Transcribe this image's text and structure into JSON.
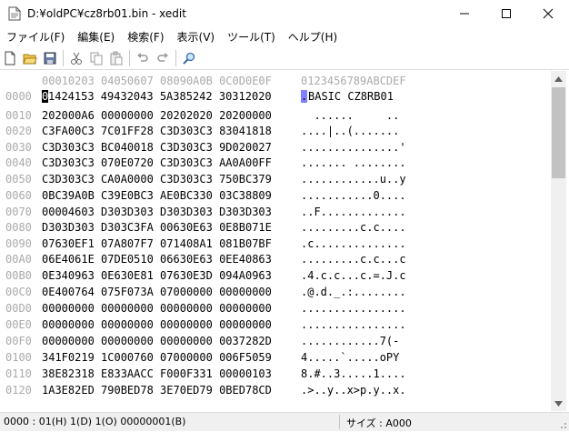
{
  "window": {
    "title": "D:¥oldPC¥cz8rb01.bin - xedit",
    "minimize_icon": "minimize-icon",
    "maximize_icon": "maximize-icon",
    "close_icon": "close-icon"
  },
  "menu": [
    {
      "label": "ファイル(F)"
    },
    {
      "label": "編集(E)"
    },
    {
      "label": "検索(F)"
    },
    {
      "label": "表示(V)"
    },
    {
      "label": "ツール(T)"
    },
    {
      "label": "ヘルプ(H)"
    }
  ],
  "toolbar": [
    "new-file-icon",
    "open-folder-icon",
    "save-icon",
    "cut-icon",
    "copy-icon",
    "paste-icon",
    "undo-icon",
    "redo-icon",
    "search-icon"
  ],
  "editor": {
    "header_hex": "00010203 04050607 08090A0B 0C0D0E0F",
    "header_ascii": "0123456789ABCDEF",
    "first_row": {
      "addr": "0000",
      "caret_hex": "0",
      "hex_rest": "1424153 49432043 5A385242 30312020",
      "caret_ascii": ".",
      "ascii_rest": "BASIC CZ8RB01"
    },
    "rows": [
      {
        "addr": "0010",
        "hex": "202000A6 00000000 20202020 20200000",
        "ascii": "  ......     .."
      },
      {
        "addr": "0020",
        "hex": "C3FA00C3 7C01FF28 C3D303C3 83041818",
        "ascii": "....|..(......."
      },
      {
        "addr": "0030",
        "hex": "C3D303C3 BC040018 C3D303C3 9D020027",
        "ascii": "...............'"
      },
      {
        "addr": "0040",
        "hex": "C3D303C3 070E0720 C3D303C3 AA0A00FF",
        "ascii": "....... ........"
      },
      {
        "addr": "0050",
        "hex": "C3D303C3 CA0A0000 C3D303C3 750BC379",
        "ascii": "............u..y"
      },
      {
        "addr": "0060",
        "hex": "0BC39A0B C39E0BC3 AE0BC330 03C38809",
        "ascii": "...........0...."
      },
      {
        "addr": "0070",
        "hex": "00004603 D303D303 D303D303 D303D303",
        "ascii": "..F............."
      },
      {
        "addr": "0080",
        "hex": "D303D303 D303C3FA 00630E63 0E8B071E",
        "ascii": ".........c.c...."
      },
      {
        "addr": "0090",
        "hex": "07630EF1 07A807F7 071408A1 081B07BF",
        "ascii": ".c.............."
      },
      {
        "addr": "00A0",
        "hex": "06E4061E 07DE0510 06630E63 0EE40863",
        "ascii": ".........c.c...c"
      },
      {
        "addr": "00B0",
        "hex": "0E340963 0E630E81 07630E3D 094A0963",
        "ascii": ".4.c.c...c.=.J.c"
      },
      {
        "addr": "00C0",
        "hex": "0E400764 075F073A 07000000 00000000",
        "ascii": ".@.d._.:........"
      },
      {
        "addr": "00D0",
        "hex": "00000000 00000000 00000000 00000000",
        "ascii": "................"
      },
      {
        "addr": "00E0",
        "hex": "00000000 00000000 00000000 00000000",
        "ascii": "................"
      },
      {
        "addr": "00F0",
        "hex": "00000000 00000000 00000000 0037282D",
        "ascii": "............7(-"
      },
      {
        "addr": "0100",
        "hex": "341F0219 1C000760 07000000 006F5059",
        "ascii": "4.....`.....oPY"
      },
      {
        "addr": "0110",
        "hex": "38E82318 E833AACC F000F331 00000103",
        "ascii": "8.#..3.....1...."
      },
      {
        "addr": "0120",
        "hex": "1A3E82ED 790BED78 3E70ED79 0BED78CD",
        "ascii": ".>..y..x>p.y..x."
      }
    ]
  },
  "status": {
    "position": "0000 : 01(H) 1(D) 1(O) 00000001(B)",
    "size": "サイズ : A000"
  }
}
